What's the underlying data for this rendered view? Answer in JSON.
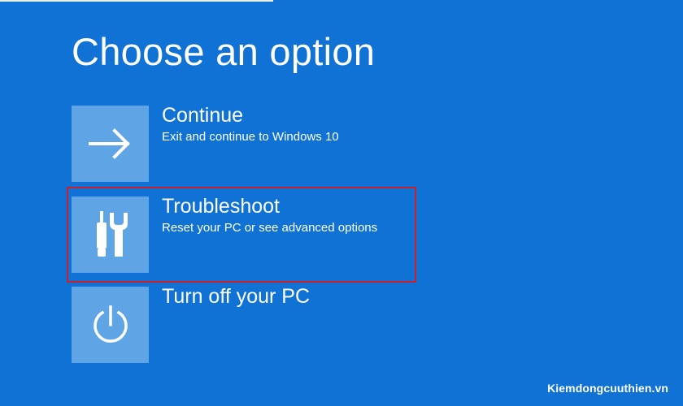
{
  "screen": {
    "title": "Choose an option",
    "background_color": "#0f72d4",
    "tile_color": "#5fa5e5",
    "highlight_color": "#cc1f2d"
  },
  "options": [
    {
      "title": "Continue",
      "description": "Exit and continue to Windows 10",
      "icon": "arrow-right-icon"
    },
    {
      "title": "Troubleshoot",
      "description": "Reset your PC or see advanced options",
      "icon": "tools-icon",
      "highlighted": true
    },
    {
      "title": "Turn off your PC",
      "description": "",
      "icon": "power-icon"
    }
  ],
  "watermark": "Kiemdongcuuthien.vn"
}
